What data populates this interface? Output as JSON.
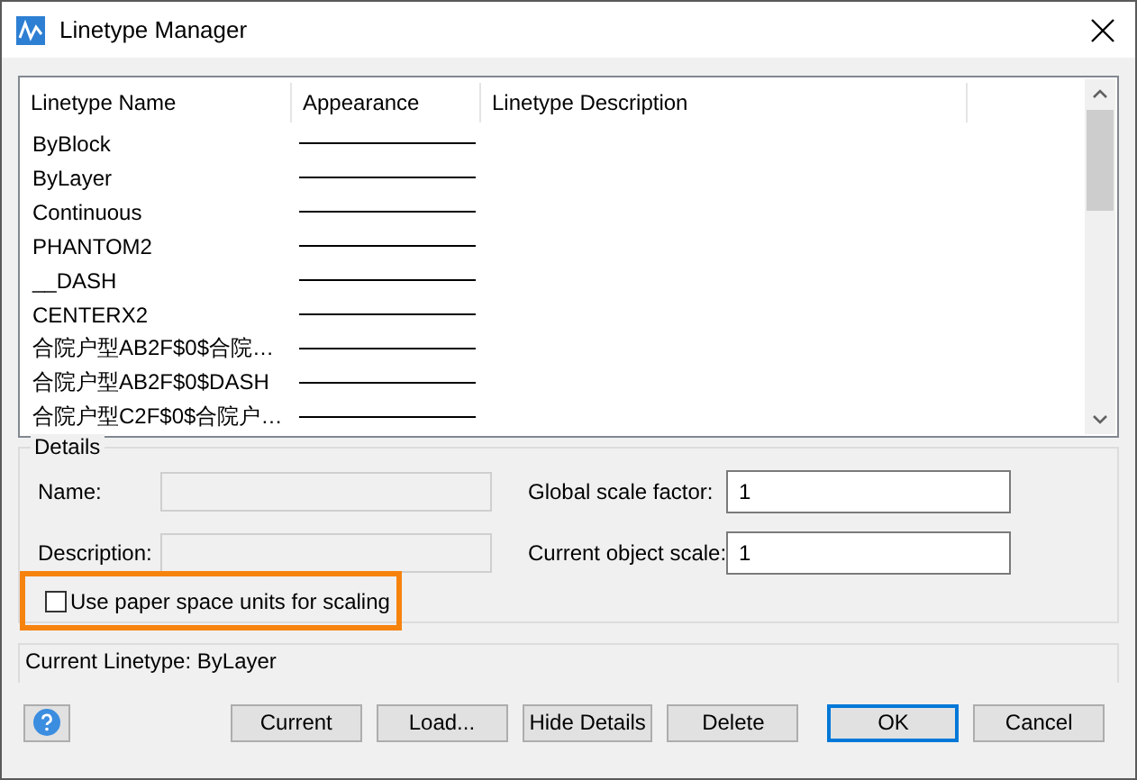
{
  "window": {
    "title": "Linetype Manager"
  },
  "table": {
    "columns": [
      "Linetype Name",
      "Appearance",
      "Linetype Description"
    ],
    "rows": [
      {
        "name": "ByBlock"
      },
      {
        "name": "ByLayer"
      },
      {
        "name": "Continuous"
      },
      {
        "name": "PHANTOM2"
      },
      {
        "name": "__DASH"
      },
      {
        "name": "CENTERX2"
      },
      {
        "name": "合院户型AB2F$0$合院…"
      },
      {
        "name": "合院户型AB2F$0$DASH"
      },
      {
        "name": "合院户型C2F$0$合院户…"
      }
    ]
  },
  "details": {
    "title": "Details",
    "fields": [
      {
        "label": "Name:",
        "disabled": true
      },
      {
        "label": "Description:",
        "disabled": true
      }
    ],
    "scale_fields": [
      {
        "label": "Global scale factor:",
        "value": "1"
      },
      {
        "label": "Current object scale:",
        "value": "1"
      }
    ],
    "checkbox": {
      "label": "Use paper space units for scaling",
      "checked": false,
      "highlighted": true
    }
  },
  "current_linetype": "Current Linetype: ByLayer",
  "buttons": [
    {
      "label": "Current",
      "default": false
    },
    {
      "label": "Load...",
      "default": false
    },
    {
      "label": "Hide Details",
      "default": false
    },
    {
      "label": "Delete",
      "default": false
    },
    {
      "label": "OK",
      "default": true
    },
    {
      "label": "Cancel",
      "default": false
    }
  ]
}
